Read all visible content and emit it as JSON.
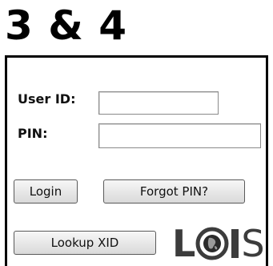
{
  "heading": "3 & 4",
  "form": {
    "user_id_label": "User ID:",
    "user_id_value": "",
    "pin_label": "PIN:",
    "pin_value": ""
  },
  "buttons": {
    "login": "Login",
    "forgot_pin": "Forgot PIN?",
    "lookup_xid": "Lookup XID"
  },
  "logo": {
    "text": "LOIS",
    "part_l": "L",
    "part_s": "S"
  }
}
